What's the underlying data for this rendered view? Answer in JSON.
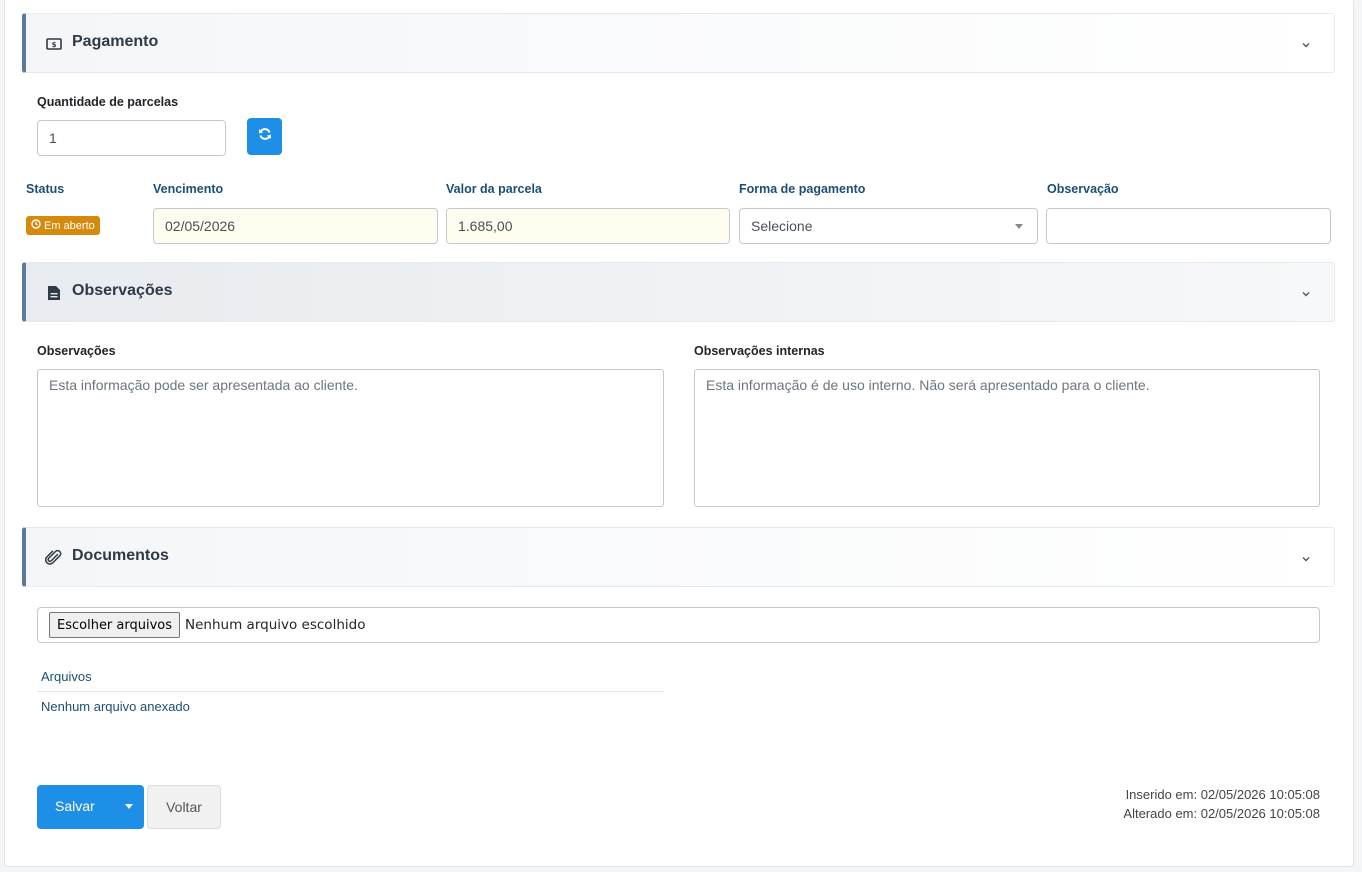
{
  "payment": {
    "title": "Pagamento",
    "icon": "money-bill-icon",
    "installments_label": "Quantidade de parcelas",
    "installments_value": "1",
    "refresh_icon": "refresh-icon",
    "columns": {
      "status": "Status",
      "due": "Vencimento",
      "amount": "Valor da parcela",
      "method": "Forma de pagamento",
      "note": "Observação"
    },
    "row": {
      "status_badge": "Em aberto",
      "status_color": "#d58a0e",
      "due_value": "02/05/2026",
      "amount_value": "1.685,00",
      "method_value": "Selecione",
      "note_value": ""
    }
  },
  "notes": {
    "title": "Observações",
    "icon": "file-icon",
    "public_label": "Observações",
    "public_placeholder": "Esta informação pode ser apresentada ao cliente.",
    "internal_label": "Observações internas",
    "internal_placeholder": "Esta informação é de uso interno. Não será apresentado para o cliente."
  },
  "documents": {
    "title": "Documentos",
    "icon": "paperclip-icon",
    "file_button": "Escolher arquivos",
    "file_status": "Nenhum arquivo escolhido",
    "files_header": "Arquivos",
    "files_empty": "Nenhum arquivo anexado"
  },
  "footer": {
    "save_label": "Salvar",
    "back_label": "Voltar",
    "inserted": "Inserido em: 02/05/2026 10:05:08",
    "updated": "Alterado em: 02/05/2026 10:05:08"
  },
  "colors": {
    "primary": "#1d8fe6",
    "section_accent": "#5b7a9c",
    "label_blue": "#1e4f73"
  }
}
